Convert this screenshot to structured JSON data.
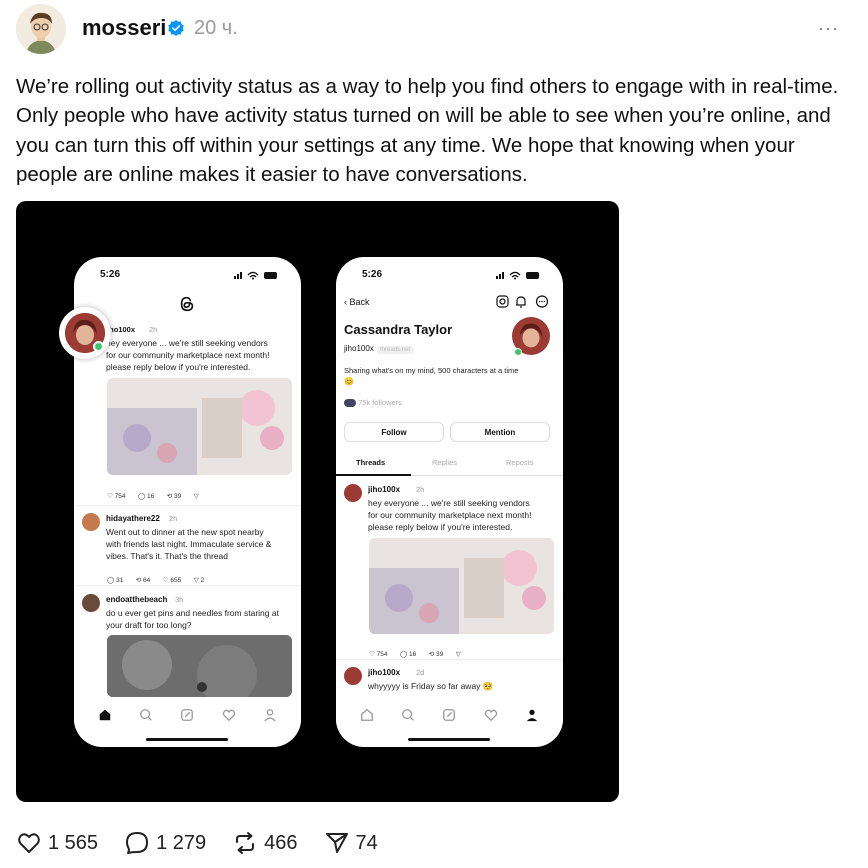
{
  "post": {
    "username": "mosseri",
    "time": "20 ч.",
    "more_label": "···",
    "text": "We’re rolling out activity status as a way to help you find others to engage with in real-time. Only people who have activity status turned on will be able to see when you’re online, and you can turn this off within your settings at any time. We hope that knowing when your people are online makes it easier to have conversations."
  },
  "phone1": {
    "status_time": "5:26",
    "post1": {
      "user": "jiho100x",
      "time": "2h",
      "text1": "hey everyone ... we're still seeking vendors",
      "text2": "for our community marketplace next month!",
      "text3": "please reply below if you're interested.",
      "likes": "754",
      "replies": "16",
      "reposts": "39"
    },
    "post2": {
      "user": "hidayathere22",
      "time": "2h",
      "text1": "Went out to dinner at the new spot nearby",
      "text2": "with friends last night. Immaculate service &",
      "text3": "vibes. That's it. That's the thread",
      "replies": "31",
      "reposts": "64",
      "likes": "655",
      "shares": "2"
    },
    "post3": {
      "user": "endoatthebeach",
      "time": "3h",
      "text1": "do u ever get pins and needles from staring at",
      "text2": "your draft for too long?"
    }
  },
  "phone2": {
    "status_time": "5:26",
    "back_label": "Back",
    "profile_name": "Cassandra Taylor",
    "handle": "jiho100x",
    "handle_badge": "threads.net",
    "bio": "Sharing what's on my mind, 500 characters at a time",
    "bio_emoji": "😊",
    "followers": "75k followers",
    "follow_label": "Follow",
    "mention_label": "Mention",
    "tabs": [
      "Threads",
      "Replies",
      "Reposts"
    ],
    "post1": {
      "user": "jiho100x",
      "time": "2h",
      "text1": "hey everyone ... we're still seeking vendors",
      "text2": "for our community marketplace next month!",
      "text3": "please reply below if you're interested.",
      "likes": "754",
      "replies": "16",
      "reposts": "39"
    },
    "post2": {
      "user": "jiho100x",
      "time": "2d",
      "text1": "whyyyyy is Friday so far away 🥺"
    }
  },
  "footer": {
    "likes": "1 565",
    "replies": "1 279",
    "reposts": "466",
    "shares": "74"
  },
  "colors": {
    "verified": "#0095f6",
    "online": "#3ec76a"
  }
}
